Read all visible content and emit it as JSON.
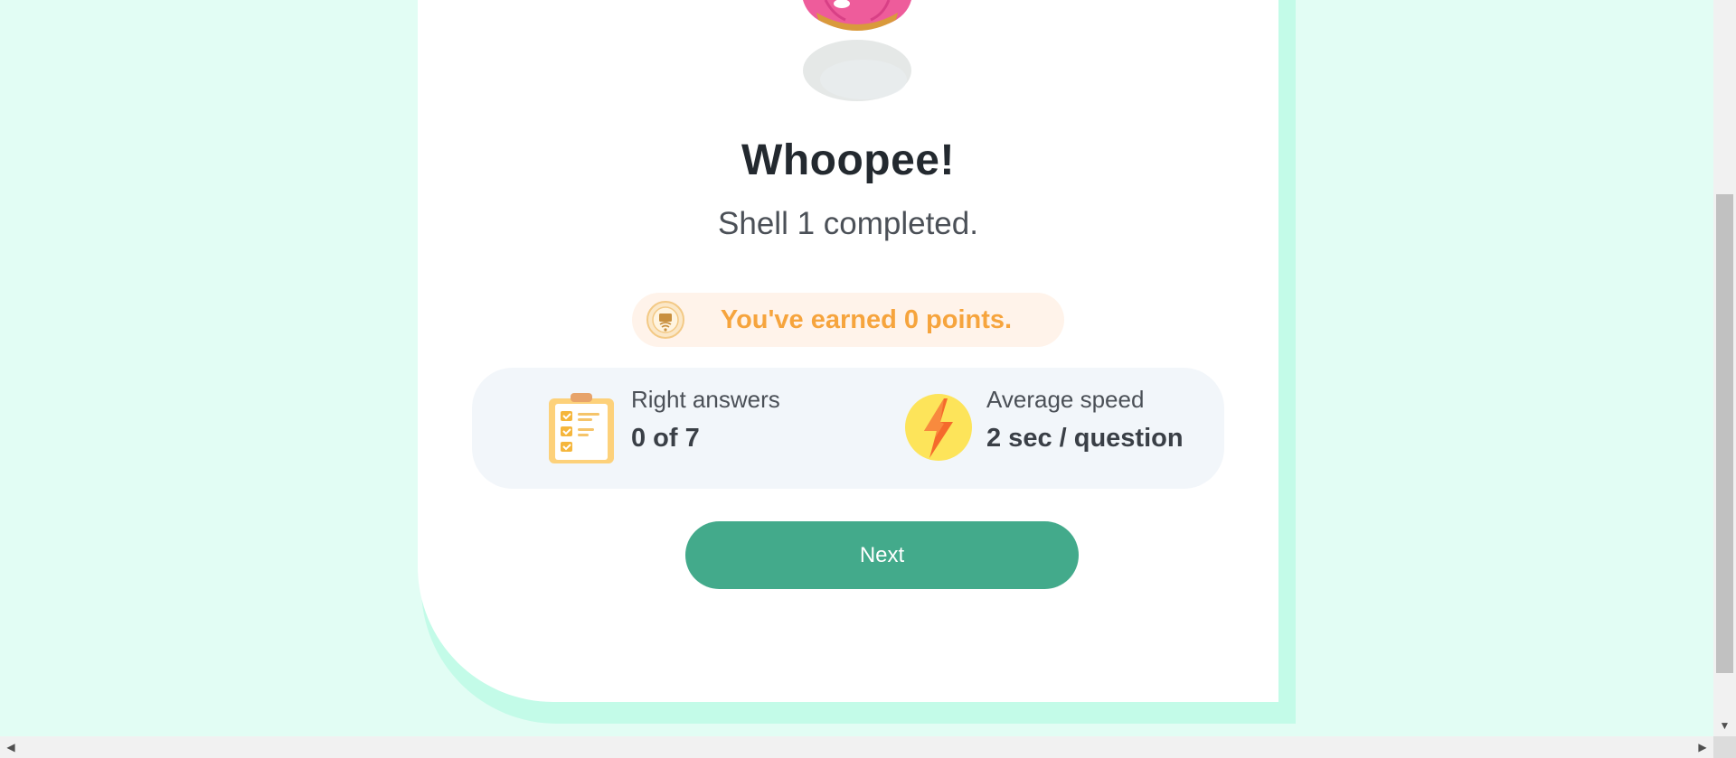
{
  "result": {
    "title": "Whoopee!",
    "subtitle": "Shell 1 completed.",
    "points_text": "You've earned 0 points."
  },
  "stats": {
    "right_answers": {
      "label": "Right answers",
      "value": "0 of 7",
      "icon": "clipboard-checklist-icon"
    },
    "average_speed": {
      "label": "Average speed",
      "value": "2 sec / question",
      "icon": "lightning-bolt-icon"
    }
  },
  "next_button": {
    "label": "Next"
  },
  "colors": {
    "background": "#e2fdf4",
    "card_shadow": "#c3fbe8",
    "points_text": "#f6a43d",
    "button": "#43aa8b"
  },
  "icons": {
    "shell": "shell-character-icon",
    "points": "points-badge-icon",
    "scroll_down": "scroll-down-arrow-icon",
    "scroll_left": "scroll-left-arrow-icon",
    "scroll_right": "scroll-right-arrow-icon"
  }
}
